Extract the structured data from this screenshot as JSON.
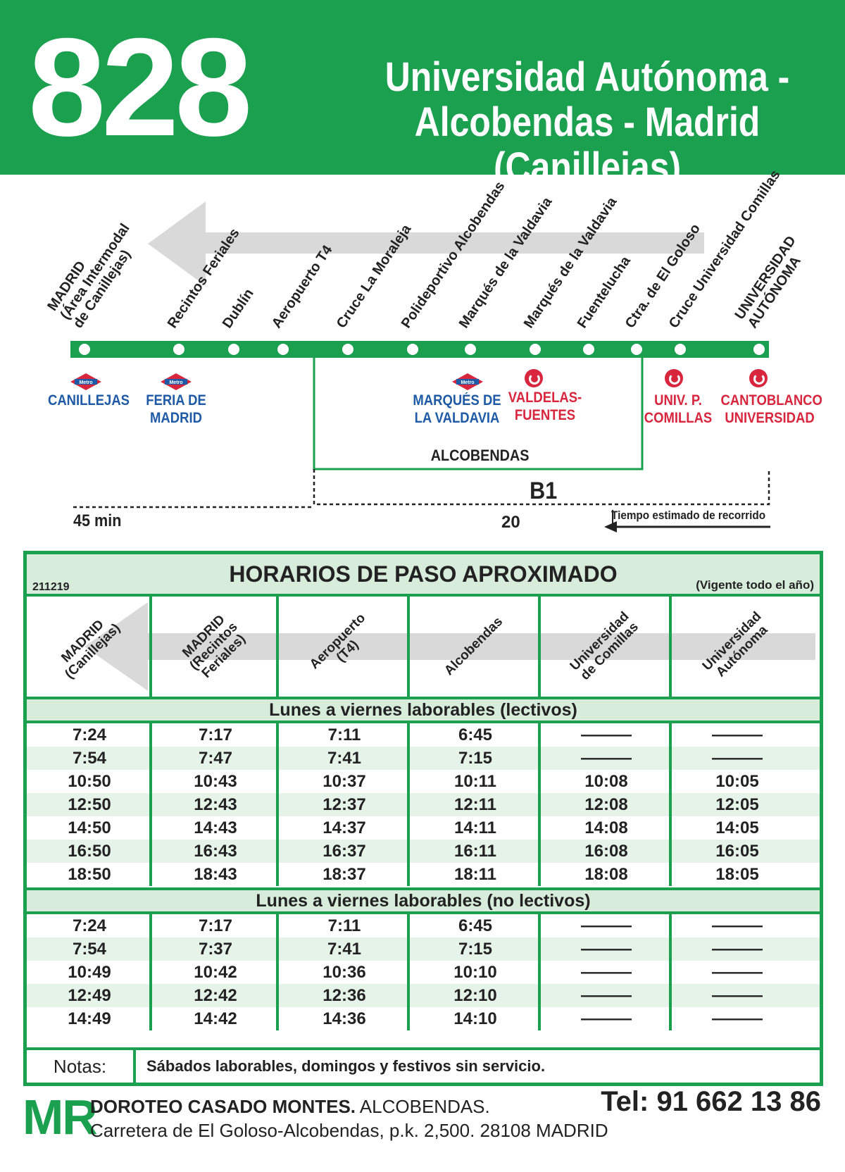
{
  "header": {
    "route_number": "828",
    "route_name_line1": "Universidad Autónoma -",
    "route_name_line2": "Alcobendas - Madrid (Canillejas)"
  },
  "colors": {
    "brand_green": "#1aa04f",
    "light_green": "#d7ecdb",
    "metro_blue": "#1e5aa6",
    "cercanias_red": "#d7263d"
  },
  "diagram": {
    "stops": [
      {
        "label": "MADRID\n(Área Intermodal\nde Canillejas)"
      },
      {
        "label": "Recintos Feriales"
      },
      {
        "label": "Dublín"
      },
      {
        "label": "Aeropuerto T4"
      },
      {
        "label": "Cruce La Moraleja"
      },
      {
        "label": "Polideportivo Alcobendas"
      },
      {
        "label": "Marqués de la Valdavia"
      },
      {
        "label": "Marqués de la Valdavia"
      },
      {
        "label": "Fuentelucha"
      },
      {
        "label": "Ctra. de El Goloso"
      },
      {
        "label": "Cruce Universidad Comillas"
      },
      {
        "label": "UNIVERSIDAD\nAUTÓNOMA"
      }
    ],
    "connections": {
      "canillejas": "CANILLEJAS",
      "feria_line1": "FERIA DE",
      "feria_line2": "MADRID",
      "marques_line1": "MARQUÉS DE",
      "marques_line2": "LA VALDAVIA",
      "valdelas_line1": "VALDELAS-",
      "valdelas_line2": "FUENTES",
      "comillas_line1": "UNIV. P.",
      "comillas_line2": "COMILLAS",
      "cantoblanco_line1": "CANTOBLANCO",
      "cantoblanco_line2": "UNIVERSIDAD"
    },
    "metro_icon_text": "Metro",
    "zone_alcobendas": "ALCOBENDAS",
    "zone_b1": "B1",
    "time_45": "45 min",
    "time_20": "20",
    "time_legend": "Tiempo estimado de recorrido"
  },
  "timetable": {
    "title": "HORARIOS DE PASO APROXIMADO",
    "code": "211219",
    "validity": "(Vigente todo el año)",
    "columns": [
      "MADRID\n(Canillejas)",
      "MADRID\n(Recintos\nFeriales)",
      "Aeropuerto\n(T4)",
      "Alcobendas",
      "Universidad\nde Comillas",
      "Universidad\nAutónoma"
    ],
    "sections": [
      {
        "title": "Lunes a viernes laborables (lectivos)",
        "rows": [
          [
            "7:24",
            "7:17",
            "7:11",
            "6:45",
            "———",
            "———"
          ],
          [
            "7:54",
            "7:47",
            "7:41",
            "7:15",
            "———",
            "———"
          ],
          [
            "10:50",
            "10:43",
            "10:37",
            "10:11",
            "10:08",
            "10:05"
          ],
          [
            "12:50",
            "12:43",
            "12:37",
            "12:11",
            "12:08",
            "12:05"
          ],
          [
            "14:50",
            "14:43",
            "14:37",
            "14:11",
            "14:08",
            "14:05"
          ],
          [
            "16:50",
            "16:43",
            "16:37",
            "16:11",
            "16:08",
            "16:05"
          ],
          [
            "18:50",
            "18:43",
            "18:37",
            "18:11",
            "18:08",
            "18:05"
          ]
        ]
      },
      {
        "title": "Lunes a viernes laborables (no lectivos)",
        "rows": [
          [
            "7:24",
            "7:17",
            "7:11",
            "6:45",
            "———",
            "———"
          ],
          [
            "7:54",
            "7:37",
            "7:41",
            "7:15",
            "———",
            "———"
          ],
          [
            "10:49",
            "10:42",
            "10:36",
            "10:10",
            "———",
            "———"
          ],
          [
            "12:49",
            "12:42",
            "12:36",
            "12:10",
            "———",
            "———"
          ],
          [
            "14:49",
            "14:42",
            "14:36",
            "14:10",
            "———",
            "———"
          ]
        ]
      }
    ],
    "notes_label": "Notas:",
    "notes_text": "Sábados laborables, domingos y festivos sin servicio."
  },
  "footer": {
    "logo": "MR",
    "company": "DOROTEO CASADO MONTES.",
    "city": " ALCOBENDAS.",
    "address": "Carretera de El Goloso-Alcobendas, p.k. 2,500. 28108 MADRID",
    "phone": "Tel: 91 662 13 86"
  }
}
